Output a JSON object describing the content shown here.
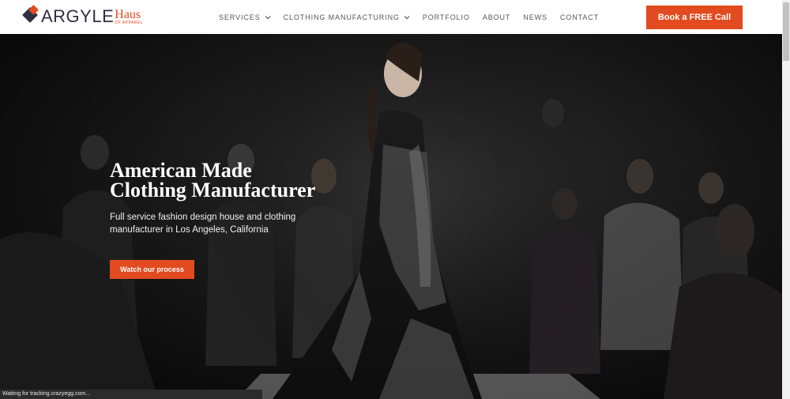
{
  "logo": {
    "main": "ARGYLE",
    "haus": "Haus",
    "tagline": "OF APPAREL"
  },
  "nav": {
    "items": [
      {
        "label": "SERVICES",
        "has_dropdown": true
      },
      {
        "label": "CLOTHING MANUFACTURING",
        "has_dropdown": true
      },
      {
        "label": "PORTFOLIO",
        "has_dropdown": false
      },
      {
        "label": "ABOUT",
        "has_dropdown": false
      },
      {
        "label": "NEWS",
        "has_dropdown": false
      },
      {
        "label": "CONTACT",
        "has_dropdown": false
      }
    ],
    "cta_label": "Book a FREE Call"
  },
  "hero": {
    "title_line1": "American Made",
    "title_line2": "Clothing Manufacturer",
    "subtitle_line1": "Full service fashion design house and clothing",
    "subtitle_line2": "manufacturer in Los Angeles, California",
    "button_label": "Watch our process"
  },
  "status_bar": {
    "text": "Waiting for tracking.crazyegg.com..."
  },
  "colors": {
    "accent": "#e24a1f",
    "logo_dark": "#2f2f44",
    "nav_text": "#555555"
  }
}
